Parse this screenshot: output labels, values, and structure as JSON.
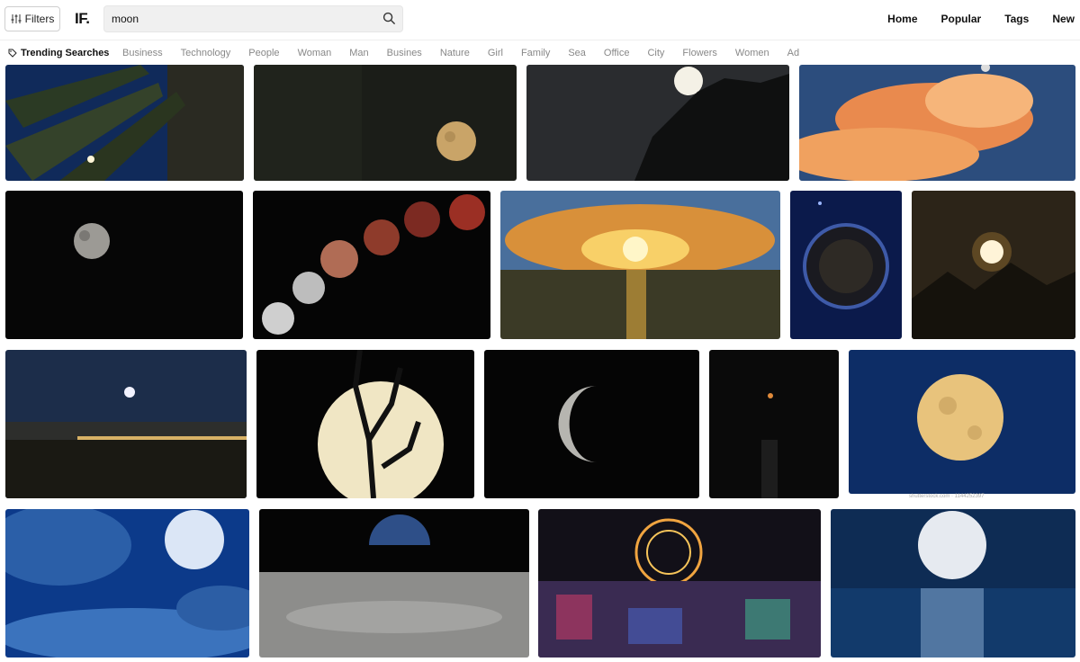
{
  "header": {
    "filters_label": "Filters",
    "logo": "IF.",
    "search_value": "moon",
    "nav": [
      "Home",
      "Popular",
      "Tags",
      "New"
    ]
  },
  "trending": {
    "label": "Trending Searches",
    "tags": [
      "Business",
      "Technology",
      "People",
      "Woman",
      "Man",
      "Busines",
      "Nature",
      "Girl",
      "Family",
      "Sea",
      "Office",
      "City",
      "Flowers",
      "Women",
      "Ad"
    ]
  },
  "watermark": "shutterstock.com · 1144252397",
  "colors": {
    "accent": "#111111",
    "tag_text": "#888888",
    "search_bg": "#f0f0f0"
  },
  "icons": {
    "filters": "sliders-icon",
    "search": "search-icon",
    "tag": "tag-icon"
  }
}
